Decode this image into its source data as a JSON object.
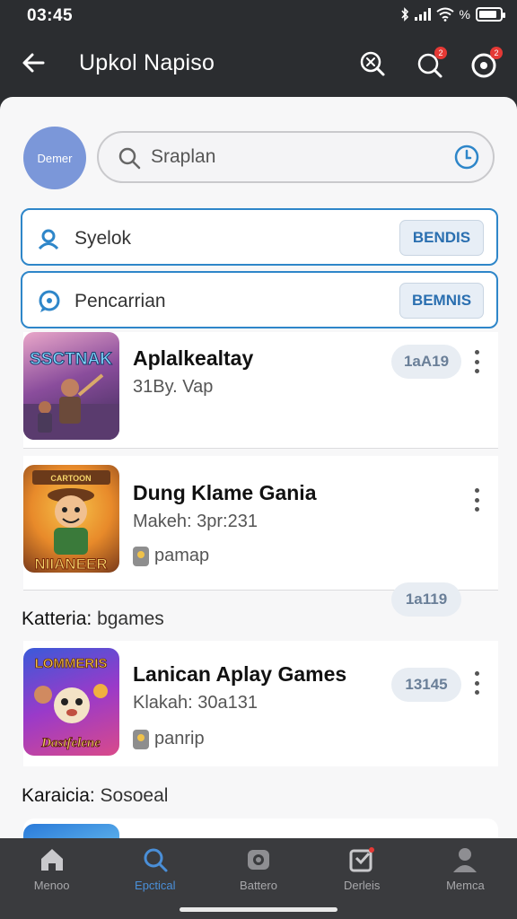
{
  "status_bar": {
    "time": "03:45",
    "icons": [
      "bluetooth-icon",
      "signal-icon",
      "wifi-icon",
      "battery-icon"
    ],
    "percent_symbol": "%"
  },
  "app_bar": {
    "title": "Upkol Napiso",
    "badge_1": "2",
    "badge_2": "2"
  },
  "profile": {
    "avatar_text": "Demer"
  },
  "search": {
    "placeholder": "Sraplan"
  },
  "filters": [
    {
      "label": "Syelok",
      "button": "BENDIS"
    },
    {
      "label": "Pencarrian",
      "button": "BEMNIS"
    }
  ],
  "games": [
    {
      "title": "Aplalkealtay",
      "subtitle": "31By. Vap",
      "button": "1aA19"
    },
    {
      "title": "Dung Klame Gania",
      "subtitle": "Makeh: 3pr:231",
      "tag": "pamap",
      "button": "1a119"
    }
  ],
  "section_1": {
    "label": "Katteria:",
    "value": "bgames"
  },
  "games_2": [
    {
      "title": "Lanican Aplay Games",
      "subtitle": "Klakah: 30a131",
      "tag": "panrip",
      "button": "13145"
    }
  ],
  "section_2": {
    "label": "Karaicia:",
    "value": "Sosoeal"
  },
  "thumbs": [
    {
      "caption": "SSCTNAK"
    },
    {
      "caption_top": "CARTOON",
      "caption_bottom": "NIIANEER"
    },
    {
      "caption_top": "LOMMERIS",
      "caption_bottom": "Dastfelene"
    }
  ],
  "bottom_nav": [
    {
      "label": "Menoo",
      "icon": "home-icon"
    },
    {
      "label": "Epctical",
      "icon": "search-icon"
    },
    {
      "label": "Battero",
      "icon": "camera-icon"
    },
    {
      "label": "Derleis",
      "icon": "badge-icon"
    },
    {
      "label": "Memca",
      "icon": "person-icon"
    }
  ],
  "colors": {
    "accent": "#2e86c9",
    "nav_active": "#4a8fd8",
    "header_bg": "#2b2d30",
    "badge": "#e53935",
    "avatar": "#7b97d9"
  }
}
